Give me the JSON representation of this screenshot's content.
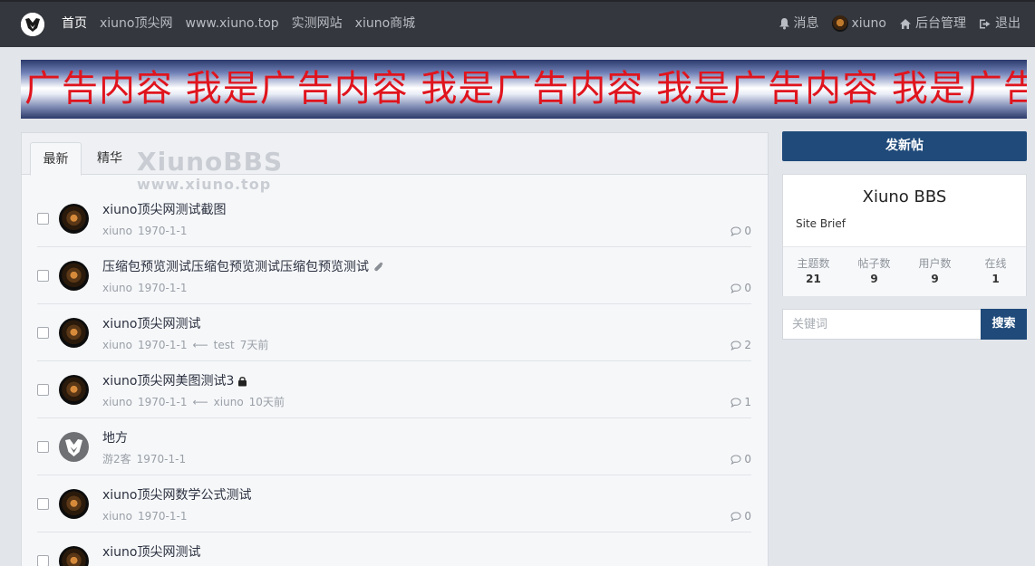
{
  "navbar": {
    "logo": "xiuno-logo-icon",
    "left": [
      "首页",
      "xiuno顶尖网",
      "www.xiuno.top",
      "实测网站",
      "xiuno商城"
    ],
    "right": {
      "messages": "消息",
      "username": "xiuno",
      "admin": "后台管理",
      "logout": "退出"
    }
  },
  "banner": {
    "text": "广告内容 我是广告内容 我是广告内容 我是广告内容 我是广告内容 我是广告内容",
    "color": "#e0141d"
  },
  "tabs": {
    "latest": "最新",
    "digest": "精华"
  },
  "watermark": {
    "title": "XiunoBBS",
    "url": "www.xiuno.top"
  },
  "threads": [
    {
      "subject": "xiuno顶尖网测试截图",
      "author": "xiuno",
      "date": "1970-1-1",
      "last_user": "",
      "last_time": "",
      "replies": "0",
      "icon": ""
    },
    {
      "subject": "压缩包预览测试压缩包预览测试压缩包预览测试",
      "author": "xiuno",
      "date": "1970-1-1",
      "last_user": "",
      "last_time": "",
      "replies": "0",
      "icon": "paperclip-icon"
    },
    {
      "subject": "xiuno顶尖网测试",
      "author": "xiuno",
      "date": "1970-1-1",
      "last_user": "test",
      "last_time": "7天前",
      "replies": "2",
      "icon": ""
    },
    {
      "subject": "xiuno顶尖网美图测试3",
      "author": "xiuno",
      "date": "1970-1-1",
      "last_user": "xiuno",
      "last_time": "10天前",
      "replies": "1",
      "icon": "lock-icon"
    },
    {
      "subject": "地方",
      "author": "游2客",
      "date": "1970-1-1",
      "last_user": "",
      "last_time": "",
      "replies": "0",
      "icon": ""
    },
    {
      "subject": "xiuno顶尖网数学公式测试",
      "author": "xiuno",
      "date": "1970-1-1",
      "last_user": "",
      "last_time": "",
      "replies": "0",
      "icon": ""
    },
    {
      "subject": "xiuno顶尖网测试",
      "author": "",
      "date": "",
      "last_user": "",
      "last_time": "",
      "replies": "",
      "icon": ""
    }
  ],
  "sidebar": {
    "post_button": "发新帖",
    "site_name": "Xiuno BBS",
    "site_brief": "Site Brief",
    "stats": [
      {
        "label": "主题数",
        "value": "21"
      },
      {
        "label": "帖子数",
        "value": "9"
      },
      {
        "label": "用户数",
        "value": "9"
      },
      {
        "label": "在线",
        "value": "1"
      }
    ],
    "search": {
      "placeholder": "关键词",
      "button": "搜索"
    }
  },
  "colors": {
    "navbar": "#34373d",
    "primary": "#1f4a7a",
    "background": "#e2e5ea"
  }
}
